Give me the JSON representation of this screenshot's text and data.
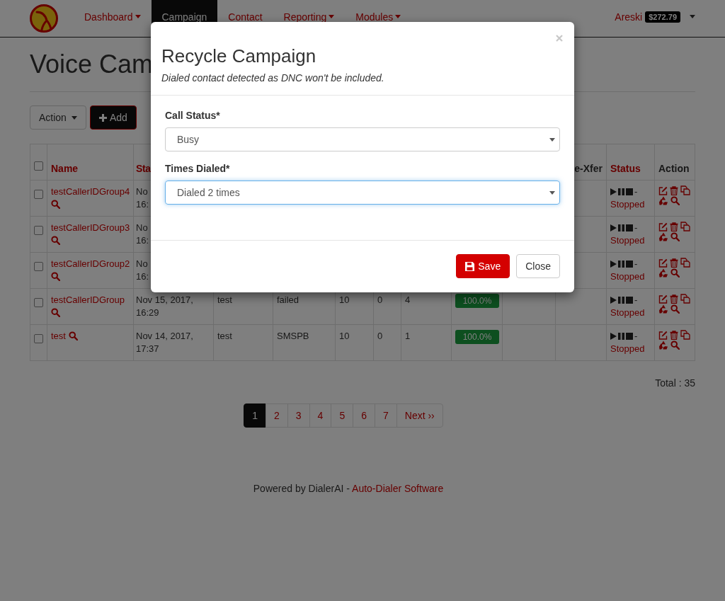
{
  "navbar": {
    "items": [
      {
        "label": "Dashboard",
        "dropdown": true,
        "selected": false
      },
      {
        "label": "Campaign",
        "dropdown": false,
        "selected": true
      },
      {
        "label": "Contact",
        "dropdown": false,
        "selected": false
      },
      {
        "label": "Reporting",
        "dropdown": true,
        "selected": false
      },
      {
        "label": "Modules",
        "dropdown": true,
        "selected": false
      }
    ],
    "user": "Areski",
    "balance": "$272.79"
  },
  "page_title": "Voice Cam",
  "toolbar": {
    "action_button": "Action",
    "add_button": "Add"
  },
  "table": {
    "header_checked": false,
    "columns": [
      {
        "label": "Name",
        "sortable": true
      },
      {
        "label": "Sta",
        "sortable": true
      },
      {
        "label": "e-Xfer",
        "sortable": false
      },
      {
        "label": "Status",
        "sortable": true
      },
      {
        "label": "Action",
        "sortable": false
      }
    ],
    "rows": [
      {
        "checked": false,
        "name": "testCallerIDGroup4",
        "start": "No\n16:",
        "status": {
          "separator": "-",
          "label": "Stopped"
        }
      },
      {
        "checked": false,
        "name": "testCallerIDGroup3",
        "start": "No\n16:",
        "status": {
          "separator": "-",
          "label": "Stopped"
        }
      },
      {
        "checked": false,
        "name": "testCallerIDGroup2",
        "start": "No\n16:",
        "status": {
          "separator": "-",
          "label": "Stopped"
        }
      },
      {
        "checked": false,
        "name": "testCallerIDGroup",
        "start": "Nov 15, 2017,\n16:29",
        "column_3": "test",
        "column_4": "failed",
        "column_5": "10",
        "column_6": "0",
        "column_7": "4",
        "progress": {
          "level": 1,
          "label": "100.0%"
        },
        "status": {
          "separator": "-",
          "label": "Stopped"
        }
      },
      {
        "checked": false,
        "name": "test",
        "start": "Nov 14, 2017,\n17:37",
        "column_3": "test",
        "column_4": "SMSPB",
        "column_5": "10",
        "column_6": "0",
        "column_7": "1",
        "progress": {
          "level": 1,
          "label": "100.0%"
        },
        "status": {
          "separator": "-",
          "label": "Stopped"
        }
      }
    ]
  },
  "total": "Total : 35",
  "pagination": [
    {
      "label": "1",
      "selected": true
    },
    {
      "label": "2",
      "selected": false
    },
    {
      "label": "3",
      "selected": false
    },
    {
      "label": "4",
      "selected": false
    },
    {
      "label": "5",
      "selected": false
    },
    {
      "label": "6",
      "selected": false
    },
    {
      "label": "7",
      "selected": false
    },
    {
      "label": "Next ››",
      "selected": false
    }
  ],
  "footer": {
    "text": "Powered by DialerAI - ",
    "link": "Auto-Dialer Software"
  },
  "modal": {
    "title": "Recycle Campaign",
    "subtitle": "Dialed contact detected as DNC won't be included.",
    "fields": [
      {
        "label": "Call Status*",
        "value": "Busy",
        "focused": false
      },
      {
        "label": "Times Dialed*",
        "value": "Dialed 2 times",
        "focused": true
      }
    ],
    "buttons": [
      {
        "kind": "save",
        "label": "Save"
      },
      {
        "kind": "close",
        "label": "Close"
      }
    ]
  }
}
